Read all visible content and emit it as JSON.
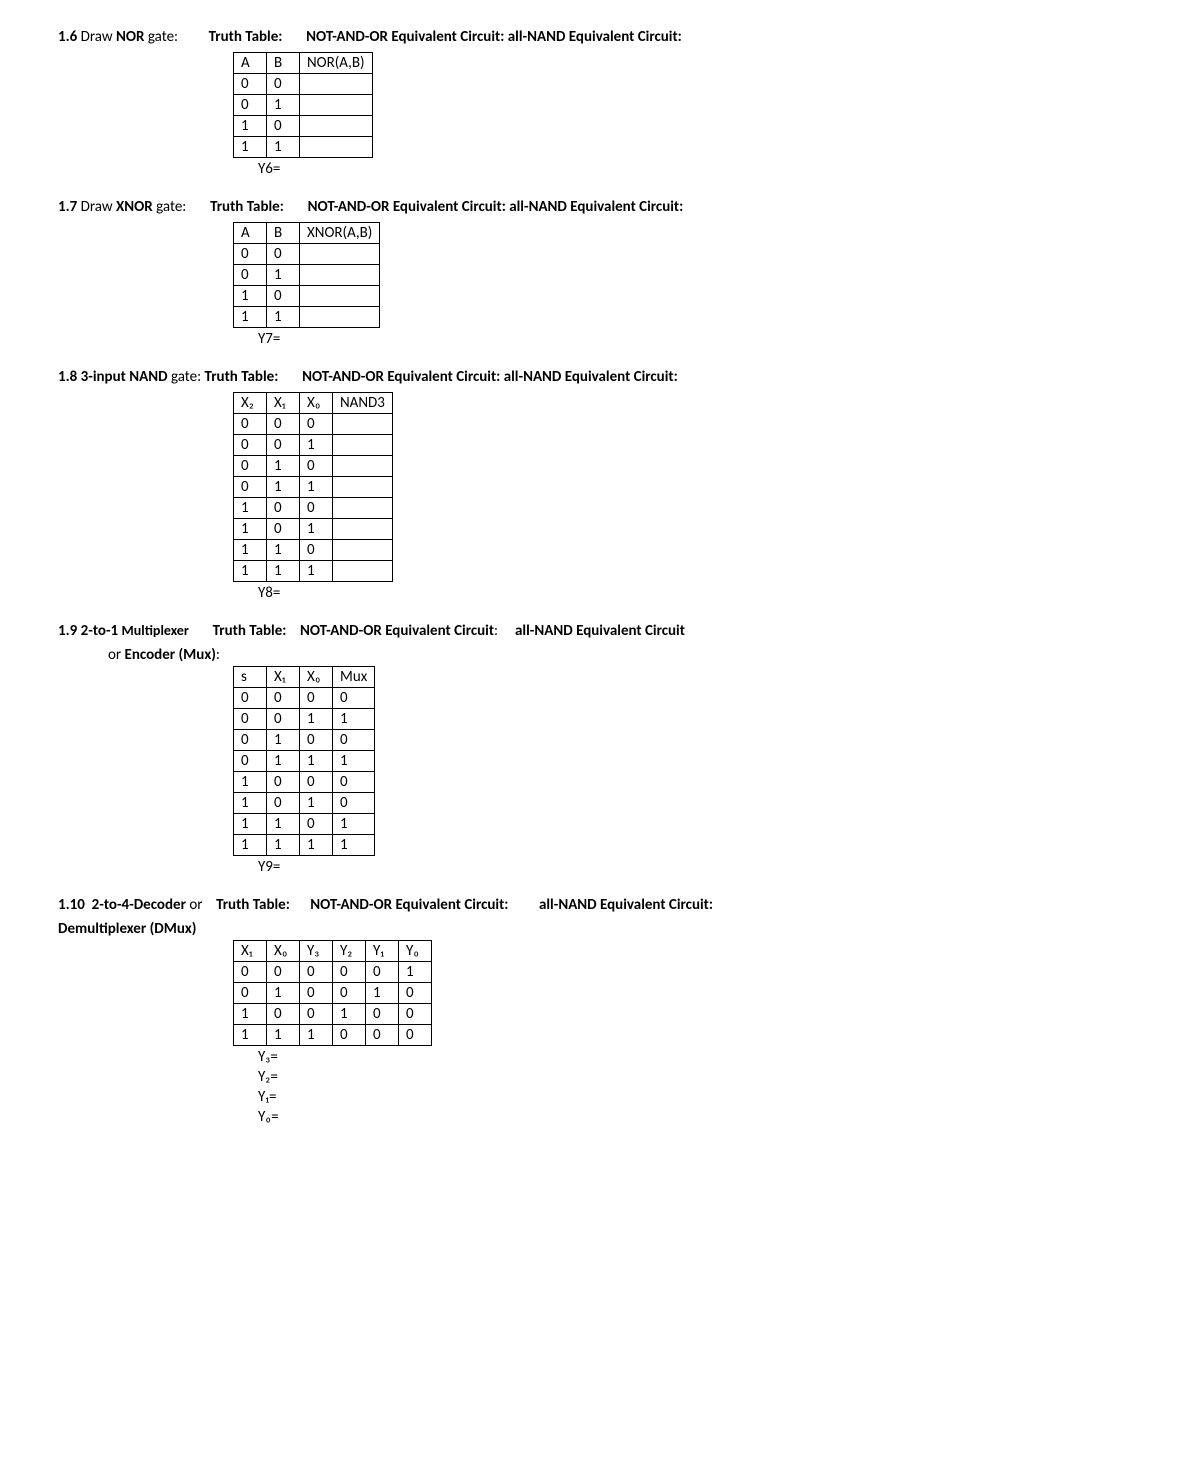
{
  "s16": {
    "prefix": "1.6",
    "draw": "Draw",
    "gate": "NOR",
    "gateSuffix": "gate:",
    "tt": "Truth Table:",
    "eq1": "NOT-AND-OR Equivalent Circuit: all-NAND Equivalent Circuit:",
    "headers": [
      "A",
      "B",
      "NOR(A,B)"
    ],
    "rows": [
      [
        "0",
        "0",
        ""
      ],
      [
        "0",
        "1",
        ""
      ],
      [
        "1",
        "0",
        ""
      ],
      [
        "1",
        "1",
        ""
      ]
    ],
    "yline": "Y6="
  },
  "s17": {
    "prefix": "1.7",
    "draw": "Draw",
    "gate": "XNOR",
    "gateSuffix": "gate:",
    "tt": "Truth Table:",
    "eq1": "NOT-AND-OR Equivalent Circuit: all-NAND Equivalent Circuit:",
    "headers": [
      "A",
      "B",
      "XNOR(A,B)"
    ],
    "rows": [
      [
        "0",
        "0",
        ""
      ],
      [
        "0",
        "1",
        ""
      ],
      [
        "1",
        "0",
        ""
      ],
      [
        "1",
        "1",
        ""
      ]
    ],
    "yline": "Y7="
  },
  "s18": {
    "prefix": "1.8",
    "gate": "3-input NAND",
    "gateSuffix": "gate:",
    "tt": "Truth Table:",
    "eq1": "NOT-AND-OR Equivalent Circuit: all-NAND Equivalent Circuit:",
    "headers": [
      "X₂",
      "X₁",
      "X₀",
      "NAND3"
    ],
    "rows": [
      [
        "0",
        "0",
        "0",
        ""
      ],
      [
        "0",
        "0",
        "1",
        ""
      ],
      [
        "0",
        "1",
        "0",
        ""
      ],
      [
        "0",
        "1",
        "1",
        ""
      ],
      [
        "1",
        "0",
        "0",
        ""
      ],
      [
        "1",
        "0",
        "1",
        ""
      ],
      [
        "1",
        "1",
        "0",
        ""
      ],
      [
        "1",
        "1",
        "1",
        ""
      ]
    ],
    "yline": "Y8="
  },
  "s19": {
    "prefix": "1.9",
    "gate1": "2-to-1",
    "gate2": "Multiplexer",
    "tt": "Truth Table:",
    "eq1a": "NOT-AND-OR Equivalent Circuit",
    "colon": ":",
    "eq1b": "all-NAND Equivalent Circuit",
    "sub": "or",
    "subBold": "Encoder (Mux)",
    "headers": [
      "s",
      "X₁",
      "X₀",
      "Mux"
    ],
    "rows": [
      [
        "0",
        "0",
        "0",
        "0"
      ],
      [
        "0",
        "0",
        "1",
        "1"
      ],
      [
        "0",
        "1",
        "0",
        "0"
      ],
      [
        "0",
        "1",
        "1",
        "1"
      ],
      [
        "1",
        "0",
        "0",
        "0"
      ],
      [
        "1",
        "0",
        "1",
        "0"
      ],
      [
        "1",
        "1",
        "0",
        "1"
      ],
      [
        "1",
        "1",
        "1",
        "1"
      ]
    ],
    "yline": "Y9="
  },
  "s110": {
    "prefix": "1.10",
    "gate1": "2-to-4-Decoder",
    "or": "or",
    "tt": "Truth Table:",
    "eq1": "NOT-AND-OR Equivalent Circuit:",
    "eq2": "all-NAND Equivalent Circuit:",
    "sub": "Demultiplexer (DMux)",
    "headers": [
      "X₁",
      "X₀",
      "Y₃",
      "Y₂",
      "Y₁",
      "Y₀"
    ],
    "rows": [
      [
        "0",
        "0",
        "0",
        "0",
        "0",
        "1"
      ],
      [
        "0",
        "1",
        "0",
        "0",
        "1",
        "0"
      ],
      [
        "1",
        "0",
        "0",
        "1",
        "0",
        "0"
      ],
      [
        "1",
        "1",
        "1",
        "0",
        "0",
        "0"
      ]
    ],
    "ylines": [
      "Y₃=",
      "Y₂=",
      "Y₁=",
      "Y₀="
    ]
  }
}
